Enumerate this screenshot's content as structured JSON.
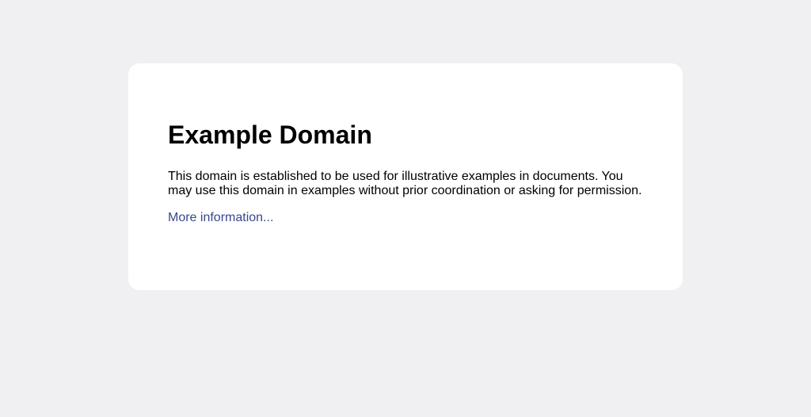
{
  "colors": {
    "page_background": "#f0f0f2",
    "card_background": "#ffffff",
    "text": "#000000",
    "link": "#38488f"
  },
  "card": {
    "title": "Example Domain",
    "description": "This domain is established to be used for illustrative examples in documents. You may use this domain in examples without prior coordination or asking for permission.",
    "link_label": "More information..."
  }
}
